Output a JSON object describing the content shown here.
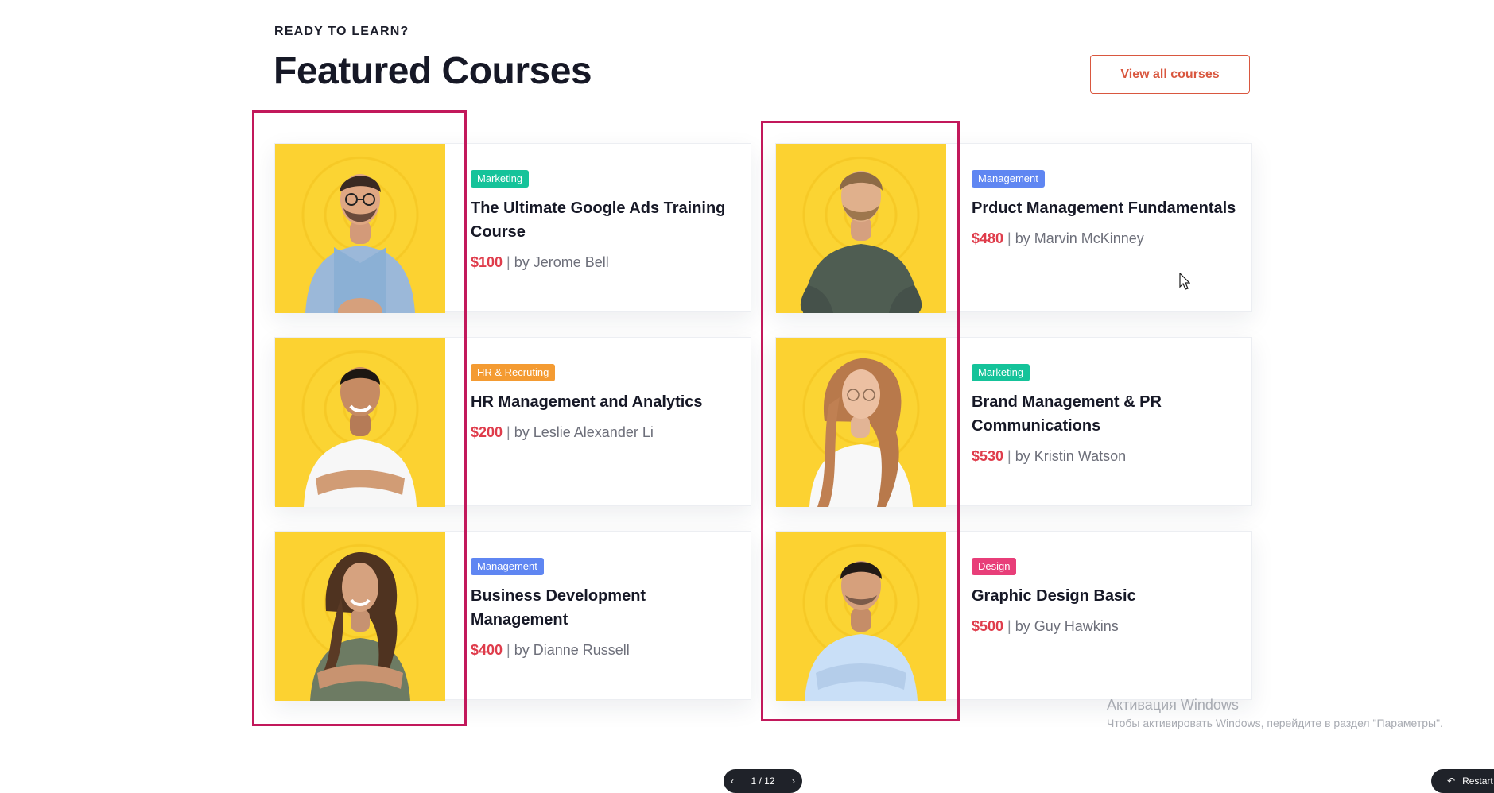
{
  "header": {
    "eyebrow": "READY TO LEARN?",
    "title": "Featured Courses",
    "view_all_label": "View all courses"
  },
  "colors": {
    "accent": "#d9573f",
    "price": "#df3c4b",
    "highlight": "#c2185b",
    "badge_marketing": "#15c39a",
    "badge_management": "#5f86f2",
    "badge_hr": "#f49b32",
    "badge_design": "#e83e79"
  },
  "courses": [
    {
      "category": "Marketing",
      "title": "The Ultimate Google Ads Training Course",
      "price": "$100",
      "author": "by Jerome Bell"
    },
    {
      "category": "Management",
      "title": "Prduct Management Fundamentals",
      "price": "$480",
      "author": "by Marvin McKinney"
    },
    {
      "category": "HR & Recruting",
      "title": "HR  Management and Analytics",
      "price": "$200",
      "author": "by Leslie Alexander Li"
    },
    {
      "category": "Marketing",
      "title": "Brand Management & PR Communications",
      "price": "$530",
      "author": "by Kristin Watson"
    },
    {
      "category": "Management",
      "title": "Business Development Management",
      "price": "$400",
      "author": "by Dianne Russell"
    },
    {
      "category": "Design",
      "title": "Graphic Design Basic",
      "price": "$500",
      "author": "by Guy Hawkins"
    }
  ],
  "windows_activation": {
    "title": "Активация Windows",
    "subtitle": "Чтобы активировать Windows, перейдите в раздел \"Параметры\"."
  },
  "player": {
    "page_indicator": "1 / 12",
    "restart_label": "Restart"
  }
}
